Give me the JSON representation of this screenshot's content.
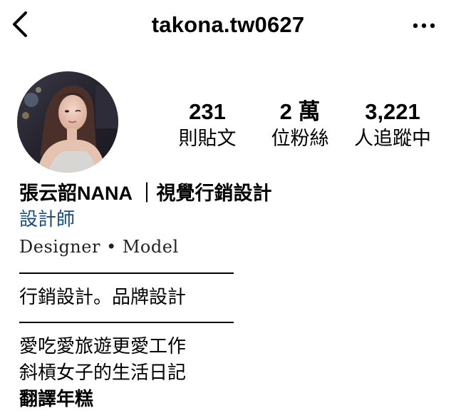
{
  "header": {
    "username": "takona.tw0627"
  },
  "stats": {
    "posts": {
      "count": "231",
      "label": "則貼文"
    },
    "followers": {
      "count": "2 萬",
      "label": "位粉絲"
    },
    "following": {
      "count": "3,221",
      "label": "人追蹤中"
    }
  },
  "bio": {
    "display_name": "張云韶NANA ｜視覺行銷設計",
    "category": "設計師",
    "line1": "Designer • Model",
    "line2": "行銷設計。品牌設計",
    "line3": "愛吃愛旅遊更愛工作",
    "line4": "斜槓女子的生活日記",
    "line5": "翻譯年糕"
  },
  "icons": {
    "back": "chevron-left-icon",
    "more": "more-horizontal-icon"
  },
  "colors": {
    "category_link": "#1a4c7e",
    "text": "#000000",
    "background": "#ffffff"
  }
}
